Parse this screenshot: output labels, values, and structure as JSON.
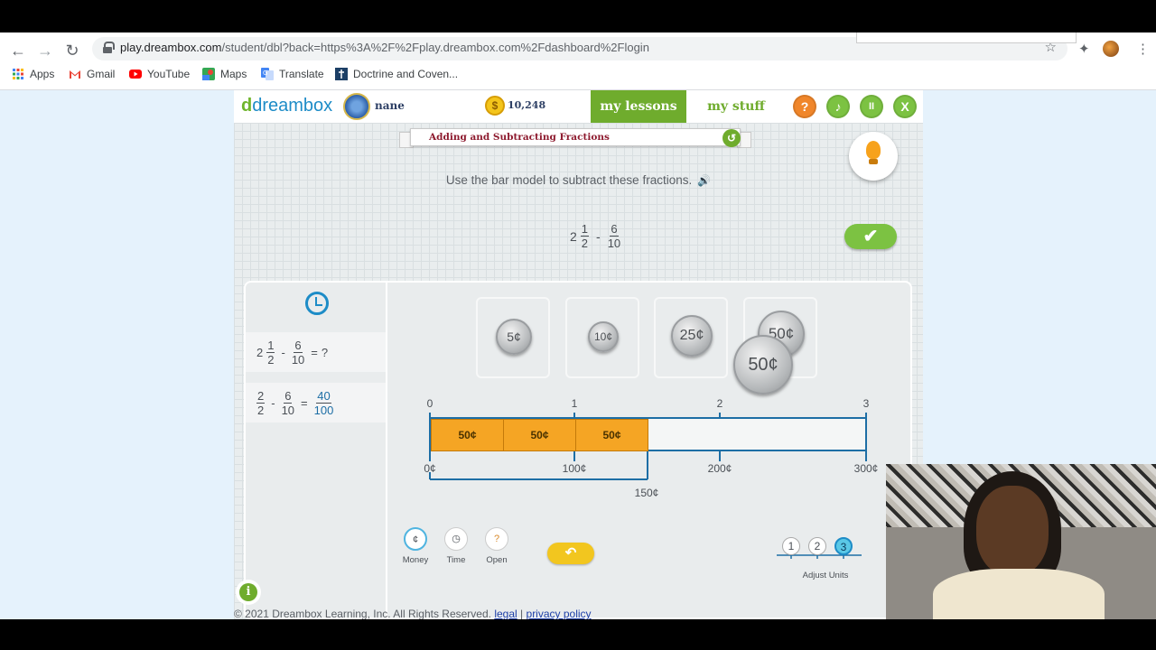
{
  "browser": {
    "url_host": "play.dreambox.com",
    "url_path": "/student/dbl?back=https%3A%2F%2Fplay.dreambox.com%2Fdashboard%2Flogin",
    "bookmarks": [
      {
        "label": "Apps",
        "icon": "apps-grid-icon"
      },
      {
        "label": "Gmail",
        "icon": "gmail-icon"
      },
      {
        "label": "YouTube",
        "icon": "youtube-icon"
      },
      {
        "label": "Maps",
        "icon": "maps-icon"
      },
      {
        "label": "Translate",
        "icon": "translate-icon"
      },
      {
        "label": "Doctrine and Coven...",
        "icon": "bookmark-page-icon"
      }
    ]
  },
  "app": {
    "logo": "dreambox",
    "username": "nane",
    "coins": "10,248",
    "nav": {
      "my_lessons": "my lessons",
      "my_stuff": "my stuff"
    },
    "buttons": {
      "help": "?",
      "sound": "♪",
      "pause": "II",
      "close": "X"
    },
    "colors": {
      "green": "#6fac2d",
      "orange": "#f5a524",
      "blue": "#1d8cc7"
    }
  },
  "lesson": {
    "title": "Adding and Subtracting Fractions",
    "instruction": "Use the bar model to subtract these fractions.",
    "problem": {
      "whole": "2",
      "num1": "1",
      "den1": "2",
      "op": "-",
      "num2": "6",
      "den2": "10"
    }
  },
  "history": [
    {
      "whole": "2",
      "num1": "1",
      "den1": "2",
      "op": "-",
      "num2": "6",
      "den2": "10",
      "eq": "=",
      "result": "?"
    },
    {
      "num1": "2",
      "den1": "2",
      "op": "-",
      "num2": "6",
      "den2": "10",
      "eq": "=",
      "rnum": "40",
      "rden": "100"
    }
  ],
  "coins_tray": [
    {
      "label": "5¢"
    },
    {
      "label": "10¢"
    },
    {
      "label": "25¢"
    },
    {
      "label": "50¢"
    }
  ],
  "dragging_coin": "50¢",
  "bar_model": {
    "top_ticks": [
      "0",
      "1",
      "2",
      "3"
    ],
    "segments": [
      "50¢",
      "50¢",
      "50¢"
    ],
    "bottom_ticks": [
      "0¢",
      "100¢",
      "200¢",
      "300¢"
    ],
    "bracket_label": "150¢"
  },
  "tools": [
    {
      "label": "Money",
      "glyph": "¢"
    },
    {
      "label": "Time",
      "glyph": "◷"
    },
    {
      "label": "Open",
      "glyph": "?"
    }
  ],
  "units": {
    "options": [
      "1",
      "2",
      "3"
    ],
    "selected": "3",
    "label": "Adjust Units"
  },
  "footer": {
    "copyright": "© 2021 Dreambox Learning, Inc. All Rights Reserved.",
    "legal": "legal",
    "sep": "|",
    "privacy": "privacy policy"
  }
}
